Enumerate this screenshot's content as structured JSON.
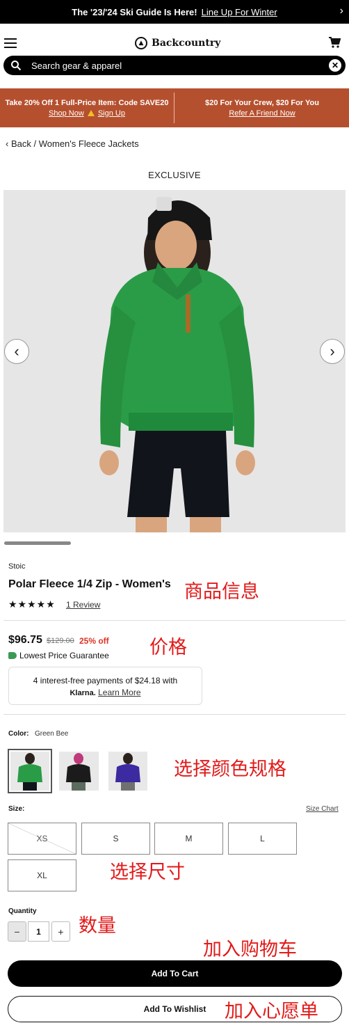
{
  "topbar": {
    "text": "The '23/'24 Ski Guide Is Here!",
    "link": "Line Up For Winter"
  },
  "header": {
    "logo": "Backcountry"
  },
  "search": {
    "placeholder": "Search gear & apparel"
  },
  "promo": {
    "left_title": "Take 20% Off 1 Full-Price Item: Code SAVE20",
    "shop_now": "Shop Now",
    "sign_up": "Sign Up",
    "right_title": "$20 For Your Crew, $20 For You",
    "refer": "Refer A Friend Now"
  },
  "breadcrumb": {
    "back": "Back",
    "separator": "/",
    "category": "Women's Fleece Jackets"
  },
  "badge": "EXCLUSIVE",
  "product": {
    "brand": "Stoic",
    "title": "Polar Fleece 1/4 Zip - Women's",
    "rating": 5,
    "stars": "★★★★★",
    "reviews": "1 Review",
    "price": "$96.75",
    "original_price": "$129.00",
    "discount": "25% off",
    "guarantee": "Lowest Price Guarantee",
    "klarna_line1": "4 interest-free payments of $24.18 with",
    "klarna_brand": "Klarna.",
    "klarna_link": "Learn More"
  },
  "color": {
    "label": "Color:",
    "selected": "Green Bee",
    "swatches": [
      "#2a9c48",
      "#1b1b1b",
      "#3b2aa0"
    ]
  },
  "size": {
    "label": "Size:",
    "chart": "Size Chart",
    "options": [
      "XS",
      "S",
      "M",
      "L",
      "XL"
    ],
    "unavailable": [
      "XS"
    ]
  },
  "quantity": {
    "label": "Quantity",
    "minus": "−",
    "value": "1",
    "plus": "+"
  },
  "actions": {
    "add_to_cart": "Add To Cart",
    "add_to_wishlist": "Add To Wishlist"
  },
  "annotations": {
    "product_info": "商品信息",
    "price": "价格",
    "color": "选择颜色规格",
    "size": "选择尺寸",
    "quantity": "数量",
    "cart": "加入购物车",
    "wishlist": "加入心愿单"
  },
  "colors": {
    "promo_bg": "#b5502f",
    "discount": "#dd3322",
    "annotation": "#e21a1a",
    "product_green": "#2a9c48"
  }
}
